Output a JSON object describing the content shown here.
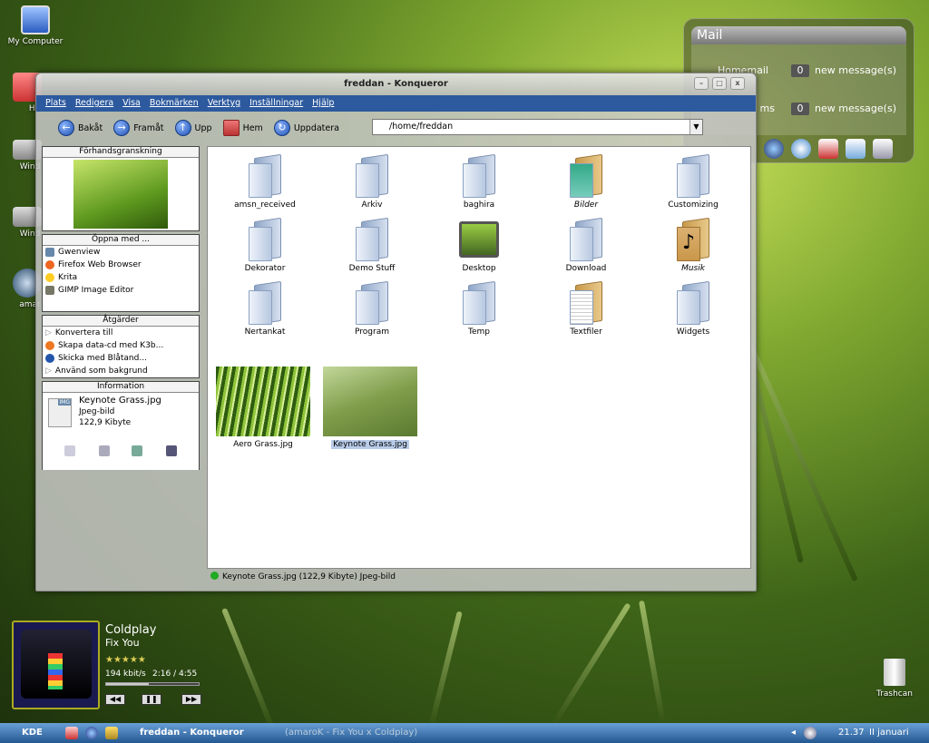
{
  "desktop": {
    "icons": [
      {
        "label": "My Computer"
      },
      {
        "label": "Ho"
      },
      {
        "label": "Wind"
      },
      {
        "label": "Wind"
      },
      {
        "label": "amar"
      }
    ],
    "trash_label": "Trashcan"
  },
  "mail_widget": {
    "title": "Mail",
    "rows": [
      {
        "name": "Homemail",
        "count": "0",
        "label": "new message(s)"
      },
      {
        "name": "ms",
        "count": "0",
        "label": "new message(s)"
      }
    ]
  },
  "window": {
    "title": "freddan - Konqueror",
    "menu": [
      "Plats",
      "Redigera",
      "Visa",
      "Bokmärken",
      "Verktyg",
      "Inställningar",
      "Hjälp"
    ],
    "toolbar": {
      "back": "Bakåt",
      "forward": "Framåt",
      "up": "Upp",
      "home": "Hem",
      "reload": "Uppdatera"
    },
    "url": "/home/freddan",
    "sidebar": {
      "preview_title": "Förhandsgranskning",
      "open_with_title": "Öppna med ...",
      "open_with": [
        "Gwenview",
        "Firefox Web Browser",
        "Krita",
        "GIMP Image Editor"
      ],
      "actions_title": "Åtgärder",
      "actions": [
        "Konvertera till",
        "Skapa data-cd med K3b...",
        "Skicka med Blåtand...",
        "Använd som bakgrund"
      ],
      "info_title": "Information",
      "info_name": "Keynote Grass.jpg",
      "info_type": "Jpeg-bild",
      "info_size": "122,9 Kibyte",
      "info_badge": "IMG"
    },
    "files": [
      {
        "name": "amsn_received"
      },
      {
        "name": "Arkiv"
      },
      {
        "name": "baghira"
      },
      {
        "name": "Bilder"
      },
      {
        "name": "Customizing"
      },
      {
        "name": "Dekorator"
      },
      {
        "name": "Demo Stuff"
      },
      {
        "name": "Desktop"
      },
      {
        "name": "Download"
      },
      {
        "name": "Musik"
      },
      {
        "name": "Nertankat"
      },
      {
        "name": "Program"
      },
      {
        "name": "Temp"
      },
      {
        "name": "Textfiler"
      },
      {
        "name": "Widgets"
      },
      {
        "name": "Aero Grass.jpg"
      },
      {
        "name": "Keynote Grass.jpg"
      }
    ],
    "status": "Keynote Grass.jpg (122,9 Kibyte)  Jpeg-bild"
  },
  "amarok": {
    "artist": "Coldplay",
    "track": "Fix You",
    "bitrate": "194 kbit/s",
    "time": "2:16 / 4:55",
    "prev": "◀◀",
    "pause": "❚❚",
    "next": "▶▶"
  },
  "taskbar": {
    "start": "KDE",
    "task_active": "freddan - Konqueror",
    "task_inactive": "(amaroK - Fix You x Coldplay)",
    "clock": "21.37",
    "date": "II januari"
  },
  "colors": {
    "menubar": "#2d5a9e",
    "taskbar": "#23578f",
    "selection": "#b8cbe8"
  }
}
